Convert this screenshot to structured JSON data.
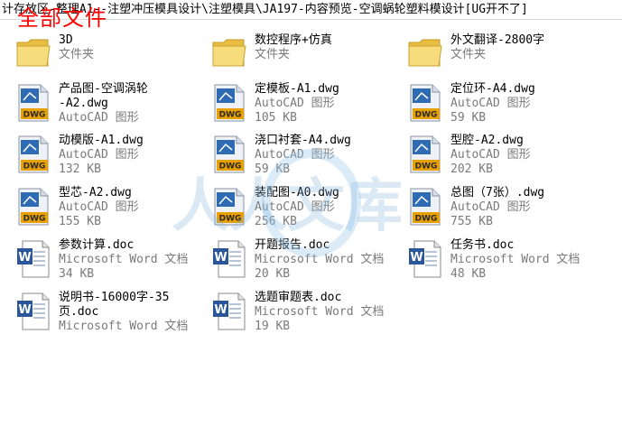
{
  "window": {
    "path": "计存放区-整理A1--注塑冲压模具设计\\注塑模具\\JA197-内容预览-空调蜗轮塑料模设计[UG开不了]",
    "overlay_title": "全部文件"
  },
  "watermark": {
    "text": "人人文库"
  },
  "colors": {
    "folder": "#f5d774",
    "dwg_label": "#e8a000",
    "word_blue": "#2b579a",
    "meta_gray": "#7a7a7a"
  },
  "files": [
    {
      "name": "3D",
      "line2": "文件夹",
      "line3": "",
      "type": "folder"
    },
    {
      "name": "数控程序+仿真",
      "line2": "文件夹",
      "line3": "",
      "type": "folder"
    },
    {
      "name": "外文翻译-2800字",
      "line2": "文件夹",
      "line3": "",
      "type": "folder"
    },
    {
      "name": "产品图-空调涡轮\n-A2.dwg",
      "line2": "AutoCAD 图形",
      "line3": "",
      "type": "dwg"
    },
    {
      "name": "定模板-A1.dwg",
      "line2": "AutoCAD 图形",
      "line3": "105 KB",
      "type": "dwg"
    },
    {
      "name": "定位环-A4.dwg",
      "line2": "AutoCAD 图形",
      "line3": "59 KB",
      "type": "dwg"
    },
    {
      "name": "动模版-A1.dwg",
      "line2": "AutoCAD 图形",
      "line3": "132 KB",
      "type": "dwg"
    },
    {
      "name": "浇口衬套-A4.dwg",
      "line2": "AutoCAD 图形",
      "line3": "59 KB",
      "type": "dwg"
    },
    {
      "name": "型腔-A2.dwg",
      "line2": "AutoCAD 图形",
      "line3": "202 KB",
      "type": "dwg"
    },
    {
      "name": "型芯-A2.dwg",
      "line2": "AutoCAD 图形",
      "line3": "155 KB",
      "type": "dwg"
    },
    {
      "name": "装配图-A0.dwg",
      "line2": "AutoCAD 图形",
      "line3": "256 KB",
      "type": "dwg"
    },
    {
      "name": "总图（7张）.dwg",
      "line2": "AutoCAD 图形",
      "line3": "755 KB",
      "type": "dwg"
    },
    {
      "name": "参数计算.doc",
      "line2": "Microsoft Word 文档",
      "line3": "34 KB",
      "type": "doc"
    },
    {
      "name": "开题报告.doc",
      "line2": "Microsoft Word 文档",
      "line3": "20 KB",
      "type": "doc"
    },
    {
      "name": "任务书.doc",
      "line2": "Microsoft Word 文档",
      "line3": "48 KB",
      "type": "doc"
    },
    {
      "name": "说明书-16000字-35\n页.doc",
      "line2": "Microsoft Word 文档",
      "line3": "",
      "type": "doc"
    },
    {
      "name": "选题审题表.doc",
      "line2": "Microsoft Word 文档",
      "line3": "19 KB",
      "type": "doc"
    }
  ]
}
